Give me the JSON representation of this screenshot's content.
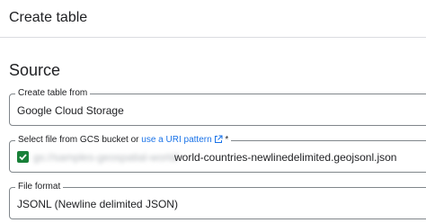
{
  "header": {
    "title": "Create table"
  },
  "section": {
    "title": "Source"
  },
  "create_from": {
    "label": "Create table from",
    "value": "Google Cloud Storage"
  },
  "gcs_file": {
    "label": "Select file from GCS bucket or ",
    "link_text": "use a URI pattern",
    "required_mark": " *",
    "redacted_prefix": "gs://samples-geospatial-world/",
    "filename": "world-countries-newlinedelimited.geojsonl.json",
    "status_color": "#188038",
    "icons": [
      "external-link-icon",
      "checkmark-icon"
    ]
  },
  "file_format": {
    "label": "File format",
    "value": "JSONL (Newline delimited JSON)"
  }
}
